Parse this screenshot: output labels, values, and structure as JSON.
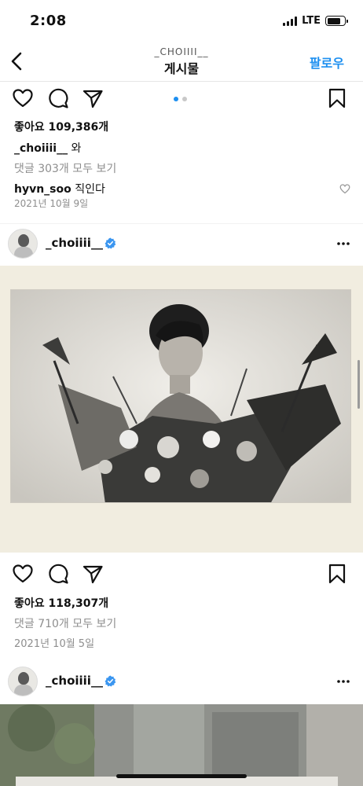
{
  "status_bar": {
    "time": "2:08",
    "network": "LTE",
    "battery_level": 0.8
  },
  "nav": {
    "username": "_CHOIIII__",
    "title": "게시물",
    "follow_label": "팔로우"
  },
  "post1": {
    "likes": "좋아요 109,386개",
    "caption_user": "_choiiii__",
    "caption_text": "와",
    "view_comments": "댓글 303개 모두 보기",
    "comment_user": "hyvn_soo",
    "comment_text": "직인다",
    "date": "2021년 10월 9일",
    "carousel_current": 1,
    "carousel_total": 2
  },
  "post2": {
    "username": "_choiiii__",
    "likes": "좋아요 118,307개",
    "view_comments": "댓글 710개 모두 보기",
    "date": "2021년 10월 5일"
  },
  "post3": {
    "username": "_choiiii__"
  },
  "colors": {
    "accent": "#1d8ff0",
    "muted": "#8e8e8e",
    "photo_bg": "#f1ede0"
  },
  "icons": [
    "back-icon",
    "heart-icon",
    "comment-icon",
    "share-icon",
    "bookmark-icon",
    "verified-icon",
    "more-icon"
  ]
}
